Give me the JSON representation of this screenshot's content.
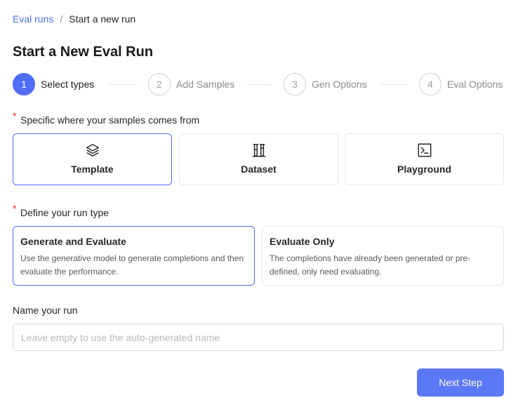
{
  "breadcrumb": {
    "parent": "Eval runs",
    "separator": "/",
    "current": "Start a new run"
  },
  "page_title": "Start a New Eval Run",
  "steps": [
    {
      "number": "1",
      "label": "Select types",
      "active": true
    },
    {
      "number": "2",
      "label": "Add Samples",
      "active": false
    },
    {
      "number": "3",
      "label": "Gen Options",
      "active": false
    },
    {
      "number": "4",
      "label": "Eval Options",
      "active": false
    }
  ],
  "source_section": {
    "required_mark": "*",
    "label": "Specific where your samples comes from",
    "options": [
      {
        "label": "Template",
        "icon": "layers-icon",
        "selected": true
      },
      {
        "label": "Dataset",
        "icon": "beakers-icon",
        "selected": false
      },
      {
        "label": "Playground",
        "icon": "terminal-icon",
        "selected": false
      }
    ]
  },
  "run_type_section": {
    "required_mark": "*",
    "label": "Define your run type",
    "options": [
      {
        "title": "Generate and Evaluate",
        "description": "Use the generative model to generate completions and then evaluate the performance.",
        "selected": true
      },
      {
        "title": "Evaluate Only",
        "description": "The completions have already been generated or pre-defined, only need evaluating.",
        "selected": false
      }
    ]
  },
  "name_section": {
    "label": "Name your run",
    "value": "",
    "placeholder": "Leave empty to use the auto-generated name"
  },
  "next_button": {
    "label": "Next Step"
  },
  "colors": {
    "primary": "#4f6df5",
    "required": "#f5222d",
    "border": "#e8e8e8"
  }
}
